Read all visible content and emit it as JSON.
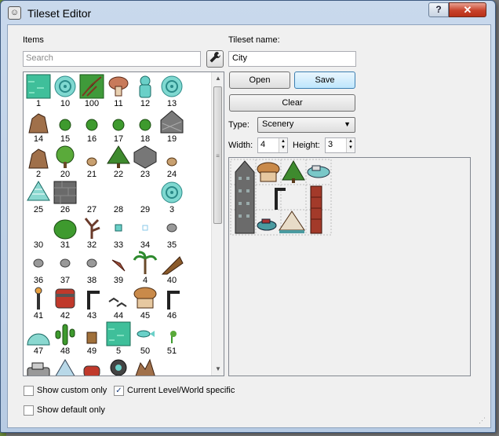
{
  "window": {
    "title": "Tileset Editor",
    "help_label": "?",
    "close_label": "✕"
  },
  "items_label": "Items",
  "search": {
    "placeholder": "Search",
    "value": ""
  },
  "tileset_name": {
    "label": "Tileset name:",
    "value": "City"
  },
  "buttons": {
    "open": "Open",
    "save": "Save",
    "clear": "Clear"
  },
  "type": {
    "label": "Type:",
    "value": "Scenery"
  },
  "width": {
    "label": "Width:",
    "value": "4"
  },
  "height": {
    "label": "Height:",
    "value": "3"
  },
  "checkboxes": {
    "show_custom_only": {
      "label": "Show custom only",
      "checked": false
    },
    "current_level_specific": {
      "label": "Current Level/World specific",
      "checked": true
    },
    "show_default_only": {
      "label": "Show default only",
      "checked": false
    }
  },
  "items": [
    {
      "label": "1",
      "icon": "grass-water-tile"
    },
    {
      "label": "10",
      "icon": "swirl-portal"
    },
    {
      "label": "100",
      "icon": "grass-crack-tile"
    },
    {
      "label": "11",
      "icon": "mushroom"
    },
    {
      "label": "12",
      "icon": "teal-statue"
    },
    {
      "label": "13",
      "icon": "swirl-portal"
    },
    {
      "label": "14",
      "icon": "rock-pile"
    },
    {
      "label": "15",
      "icon": "small-bush"
    },
    {
      "label": "16",
      "icon": "small-bush"
    },
    {
      "label": "17",
      "icon": "small-bush"
    },
    {
      "label": "18",
      "icon": "small-bush"
    },
    {
      "label": "19",
      "icon": "stone-roof"
    },
    {
      "label": "2",
      "icon": "rock-pile"
    },
    {
      "label": "20",
      "icon": "round-tree"
    },
    {
      "label": "21",
      "icon": "small-rock"
    },
    {
      "label": "22",
      "icon": "pine-tree"
    },
    {
      "label": "23",
      "icon": "stone-wedge"
    },
    {
      "label": "24",
      "icon": "small-rock"
    },
    {
      "label": "25",
      "icon": "snowy-tree"
    },
    {
      "label": "26",
      "icon": "stone-block"
    },
    {
      "label": "27",
      "icon": "",
      "col": 3
    },
    {
      "label": "28",
      "icon": ""
    },
    {
      "label": "29",
      "icon": ""
    },
    {
      "label": "3",
      "icon": "swirl-portal"
    },
    {
      "label": "30",
      "icon": ""
    },
    {
      "label": "31",
      "icon": "big-bush"
    },
    {
      "label": "32",
      "icon": "dead-tree"
    },
    {
      "label": "33",
      "icon": "tiny-gem"
    },
    {
      "label": "34",
      "icon": "tiny-sparkle"
    },
    {
      "label": "35",
      "icon": "small-stone"
    },
    {
      "label": "36",
      "icon": "small-stone"
    },
    {
      "label": "37",
      "icon": "small-stone"
    },
    {
      "label": "38",
      "icon": "small-stone"
    },
    {
      "label": "39",
      "icon": "feather"
    },
    {
      "label": "4",
      "icon": "palm-tree"
    },
    {
      "label": "40",
      "icon": "wooden-ramp"
    },
    {
      "label": "41",
      "icon": "lamp-post"
    },
    {
      "label": "42",
      "icon": "barrel"
    },
    {
      "label": "43",
      "icon": "street-lamp"
    },
    {
      "label": "44",
      "icon": "bird-flock"
    },
    {
      "label": "45",
      "icon": "gazebo"
    },
    {
      "label": "46",
      "icon": "street-lamp"
    },
    {
      "label": "47",
      "icon": "igloo"
    },
    {
      "label": "48",
      "icon": "cactus"
    },
    {
      "label": "49",
      "icon": "crate"
    },
    {
      "label": "5",
      "icon": "grass-water-tile"
    },
    {
      "label": "50",
      "icon": "small-fish"
    },
    {
      "label": "51",
      "icon": "sprout"
    },
    {
      "label": "",
      "icon": "car"
    },
    {
      "label": "",
      "icon": "tent"
    },
    {
      "label": "",
      "icon": "pot"
    },
    {
      "label": "",
      "icon": "statue-head"
    },
    {
      "label": "",
      "icon": "rock-formation"
    },
    {
      "label": "",
      "icon": ""
    }
  ],
  "preview_tiles": [
    "skyscraper",
    "gazebo",
    "pine-tree",
    "teal-boat",
    "street-lamp",
    "red-tower",
    "teal-boat-2",
    "tent"
  ],
  "colors": {
    "accent": "#3c7fb1",
    "title_bar": "#c9d9ec",
    "close_button": "#c7422b"
  }
}
